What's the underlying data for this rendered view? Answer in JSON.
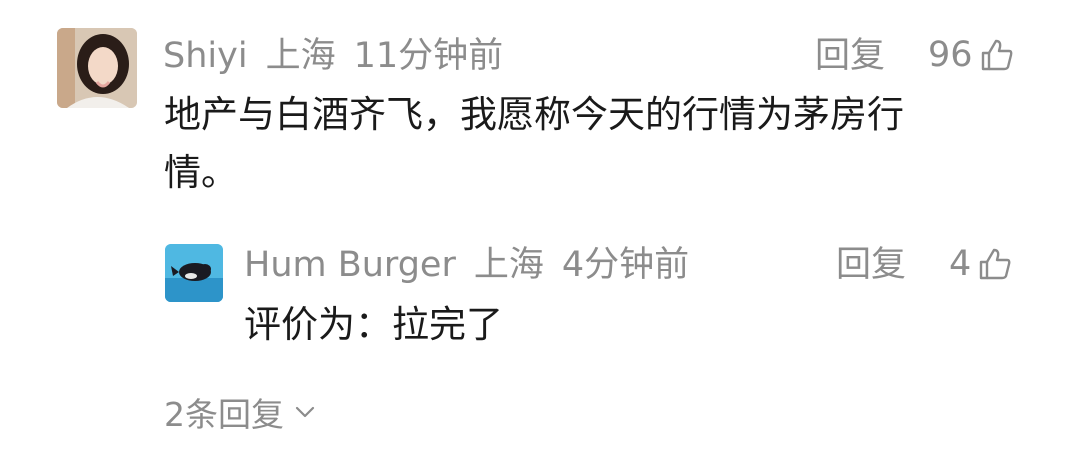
{
  "comment": {
    "author": "Shiyi",
    "location": "上海",
    "time": "11分钟前",
    "reply_label": "回复",
    "like_count": "96",
    "text": "地产与白酒齐飞，我愿称今天的行情为茅房行情。",
    "line1": "地产与白酒齐飞，我愿称今天的行情为茅房行",
    "line2": "情。"
  },
  "reply": {
    "author": "Hum Burger",
    "location": "上海",
    "time": "4分钟前",
    "reply_label": "回复",
    "like_count": "4",
    "text": "评价为：拉完了"
  },
  "more_replies": {
    "label": "2条回复"
  },
  "icons": {
    "like": "thumbs-up-icon",
    "expand": "chevron-down-icon"
  },
  "colors": {
    "meta_text": "#8c8c8c",
    "body_text": "#1a1a1a",
    "background": "#ffffff"
  }
}
